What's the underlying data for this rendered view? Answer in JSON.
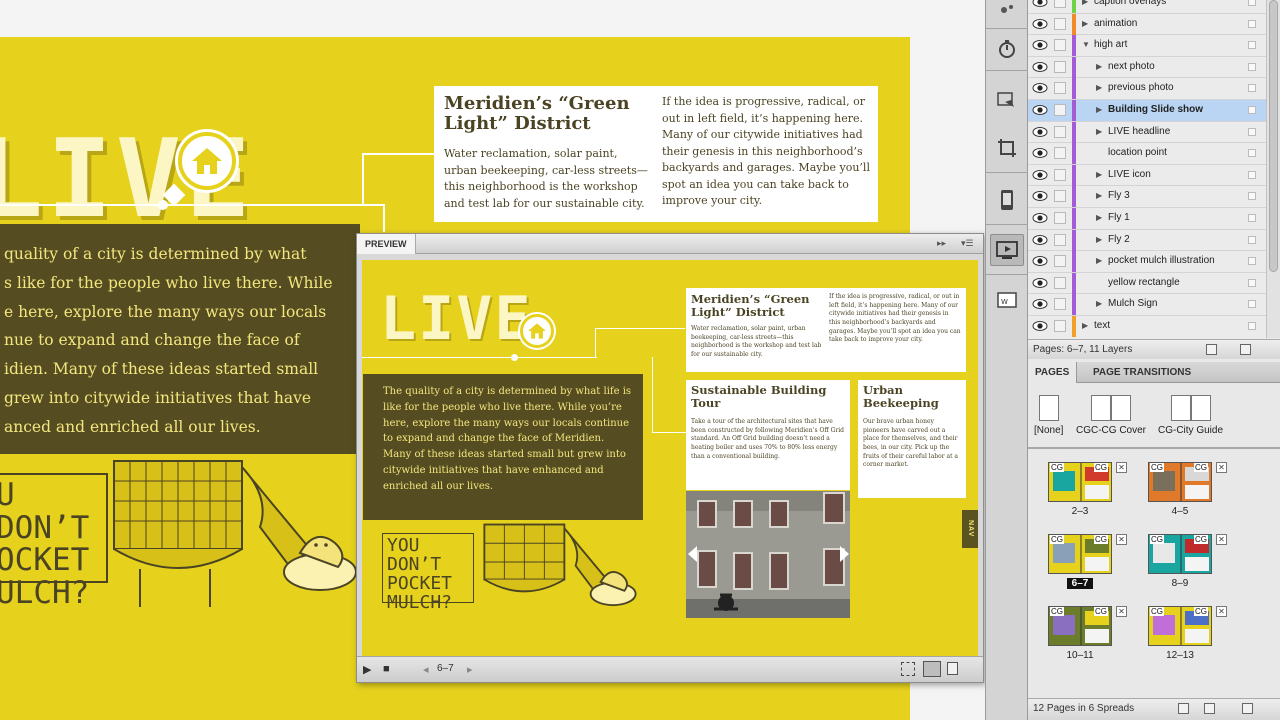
{
  "document": {
    "live_headline": "LIVE",
    "callout": {
      "title": "Meridien’s “Green Light” District",
      "col1": "Water reclamation, solar paint, urban beekeeping, car-less streets—this neighborhood is the workshop and test lab for our sustainable city.",
      "col2": "If the idea is progressive, radical, or out in left field, it’s happening here. Many of our citywide initiatives had their genesis in this neighborhood’s backyards and garages. Maybe you’ll spot an idea you can take back to improve your city."
    },
    "intro_lines": [
      "quality of a city is determined by what",
      "s like for the people who live there. While",
      "e here, explore the many ways our locals",
      "nue to expand and change the face of",
      "idien. Many of these ideas started small",
      "grew into citywide initiatives that  have",
      "anced and enriched all our lives."
    ],
    "pocket_lines": [
      "U DON’T",
      "OCKET",
      "ULCH?"
    ]
  },
  "preview": {
    "tab_label": "PREVIEW",
    "live_headline": "LIVE",
    "callout_title": "Meridien’s “Green Light” District",
    "callout_col1": "Water reclamation, solar paint, urban beekeeping, car-less streets—this neighborhood is the workshop and test lab for our sustainable city.",
    "callout_col2": "If the idea is progressive, radical, or out in left field, it’s happening here. Many of our citywide initiatives had their genesis in this neighborhood’s backyards and garages. Maybe you’ll spot an idea you can take back to improve your city.",
    "intro": "The quality of a city is determined by what life is like for the people who live there. While you’re here, explore the many ways our locals continue to expand and change the face of Meridien. Many of these ideas started small but grew into citywide initiatives that  have enhanced and enriched all our lives.",
    "tour_title": "Sustainable Building Tour",
    "tour_body": "Take a tour of the architectural sites that have been constructed by following Meridien’s Off Grid standard. An Off Grid building doesn’t need a heating boiler and uses 70% to 80% less energy than a conventional building.",
    "bee_title": "Urban Beekeeping",
    "bee_body": "Our brave urban honey pioneers have carved out a place for themselves, and their bees, in our city. Pick up the fruits of their careful labor at a corner market.",
    "pocket_lines": [
      "YOU DON’T",
      "POCKET",
      "MULCH?"
    ],
    "nav_tab": "NAV",
    "page_number": "6–7"
  },
  "layers": {
    "rows": [
      {
        "name": "caption overlays",
        "level": 0,
        "expanded": false,
        "color": "#6fd34a"
      },
      {
        "name": "animation",
        "level": 0,
        "expanded": false,
        "color": "#f08a2a"
      },
      {
        "name": "high art",
        "level": 0,
        "expanded": true,
        "color": "#a35bd6"
      },
      {
        "name": "next photo",
        "level": 1,
        "expanded": false,
        "color": "#a35bd6"
      },
      {
        "name": "previous photo",
        "level": 1,
        "expanded": false,
        "color": "#a35bd6"
      },
      {
        "name": "Building Slide show",
        "level": 1,
        "expanded": false,
        "color": "#a35bd6",
        "selected": true
      },
      {
        "name": "LIVE headline",
        "level": 1,
        "expanded": false,
        "color": "#a35bd6"
      },
      {
        "name": "location point",
        "level": 1,
        "expanded": null,
        "color": "#a35bd6"
      },
      {
        "name": "LIVE icon",
        "level": 1,
        "expanded": false,
        "color": "#a35bd6"
      },
      {
        "name": "Fly 3",
        "level": 1,
        "expanded": false,
        "color": "#a35bd6"
      },
      {
        "name": "Fly 1",
        "level": 1,
        "expanded": false,
        "color": "#a35bd6"
      },
      {
        "name": "Fly 2",
        "level": 1,
        "expanded": false,
        "color": "#a35bd6"
      },
      {
        "name": "pocket mulch illustration",
        "level": 1,
        "expanded": false,
        "color": "#a35bd6"
      },
      {
        "name": "yellow rectangle",
        "level": 1,
        "expanded": null,
        "color": "#a35bd6"
      },
      {
        "name": "Mulch Sign",
        "level": 1,
        "expanded": false,
        "color": "#a35bd6"
      },
      {
        "name": "text",
        "level": 0,
        "expanded": false,
        "color": "#f0a02a"
      }
    ],
    "footer": "Pages: 6–7, 11 Layers"
  },
  "pages": {
    "tab_pages": "PAGES",
    "tab_transitions": "PAGE TRANSITIONS",
    "masters": [
      "[None]",
      "CGC-CG Cover",
      "CG-City Guide"
    ],
    "spreads": [
      {
        "label": "2–3",
        "selected": false
      },
      {
        "label": "4–5",
        "selected": false
      },
      {
        "label": "6–7",
        "selected": true
      },
      {
        "label": "8–9",
        "selected": false
      },
      {
        "label": "10–11",
        "selected": false
      },
      {
        "label": "12–13",
        "selected": false
      }
    ],
    "thumb_prefix": "CG",
    "footer": "12 Pages in 6 Spreads"
  },
  "colors": {
    "page_yellow": "#e6d21d",
    "dark_olive": "#554d21",
    "layer_selection": "#b9d5f3"
  }
}
